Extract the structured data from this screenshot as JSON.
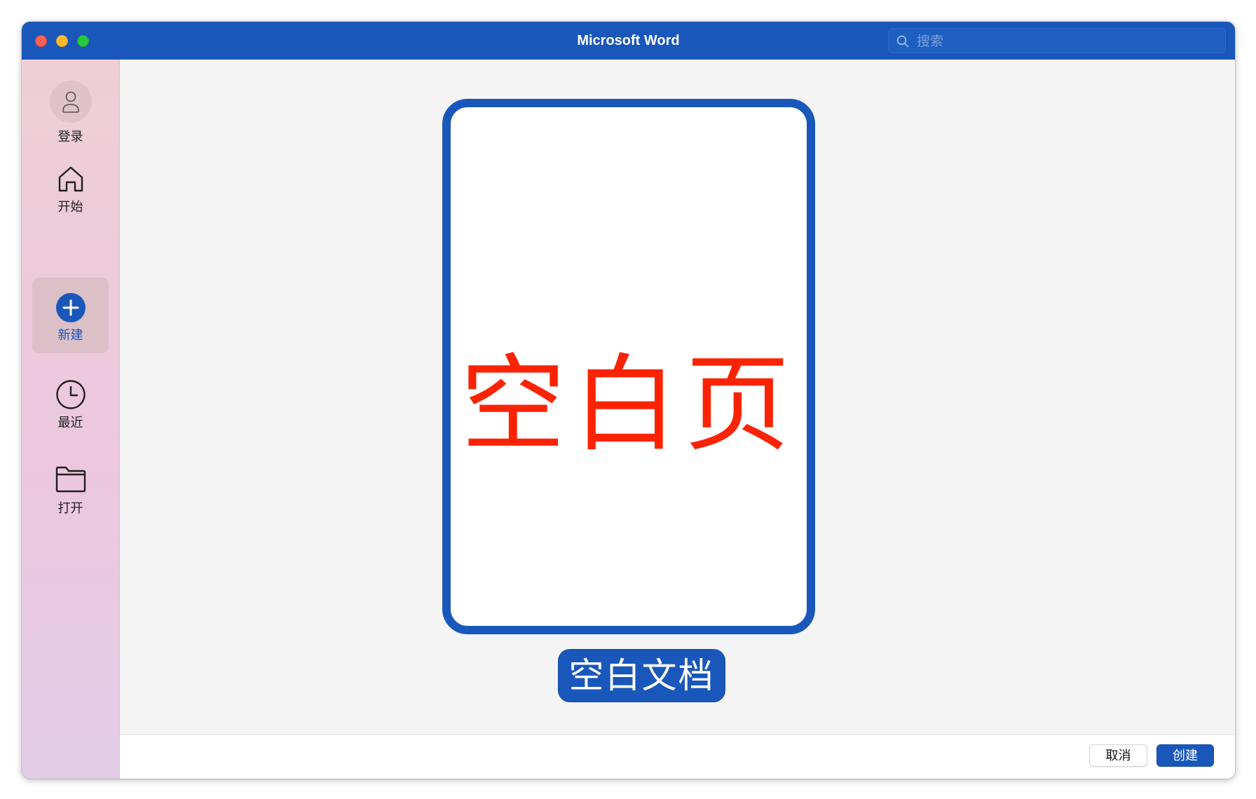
{
  "window": {
    "title": "Microsoft Word"
  },
  "search": {
    "placeholder": "搜索",
    "value": ""
  },
  "sidebar": {
    "items": [
      {
        "label": "登录",
        "icon": "person-icon",
        "active": false
      },
      {
        "label": "开始",
        "icon": "home-icon",
        "active": false
      },
      {
        "label": "新建",
        "icon": "plus-circle-icon",
        "active": true
      },
      {
        "label": "最近",
        "icon": "clock-icon",
        "active": false
      },
      {
        "label": "打开",
        "icon": "folder-icon",
        "active": false
      }
    ]
  },
  "main": {
    "template": {
      "preview_text": "空白页",
      "label": "空白文档"
    }
  },
  "footer": {
    "cancel_label": "取消",
    "create_label": "创建"
  },
  "colors": {
    "accent": "#1a57bb",
    "annotation_red": "#fa2405"
  }
}
